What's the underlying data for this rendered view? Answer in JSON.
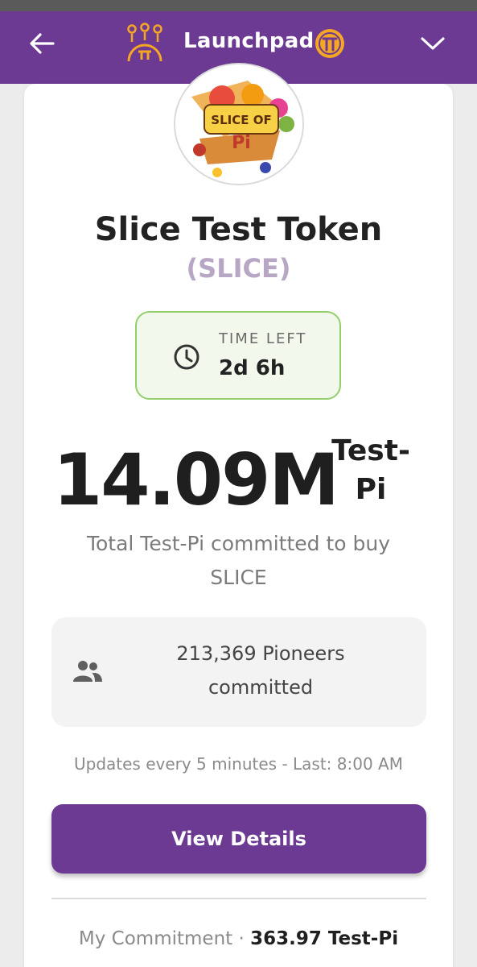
{
  "header": {
    "title": "Launchpad",
    "back_icon": "arrow-left-icon",
    "menu_icon": "chevron-down-icon",
    "logo_icon": "launchpad-logo-icon",
    "coin_icon": "pi-coin-icon",
    "bg_color": "#6c3a93"
  },
  "token": {
    "name": "Slice Test Token",
    "symbol": "(SLICE)",
    "logo_text": "SLICE OF Pi"
  },
  "timer": {
    "label": "TIME LEFT",
    "value": "2d 6h",
    "icon": "clock-icon"
  },
  "commitment": {
    "amount": "14.09M",
    "unit": "Test-Pi",
    "description": "Total Test-Pi committed to buy SLICE"
  },
  "pioneers": {
    "text": "213,369 Pioneers committed",
    "icon": "people-icon"
  },
  "updates_text": "Updates every 5 minutes - Last: 8:00 AM",
  "view_details_label": "View Details",
  "my_commitment": {
    "label": "My Commitment ·",
    "value": "363.97 Test-Pi"
  },
  "colors": {
    "primary": "#6c3a93",
    "timer_border": "#93cf6a",
    "symbol": "#b7a6c4"
  }
}
